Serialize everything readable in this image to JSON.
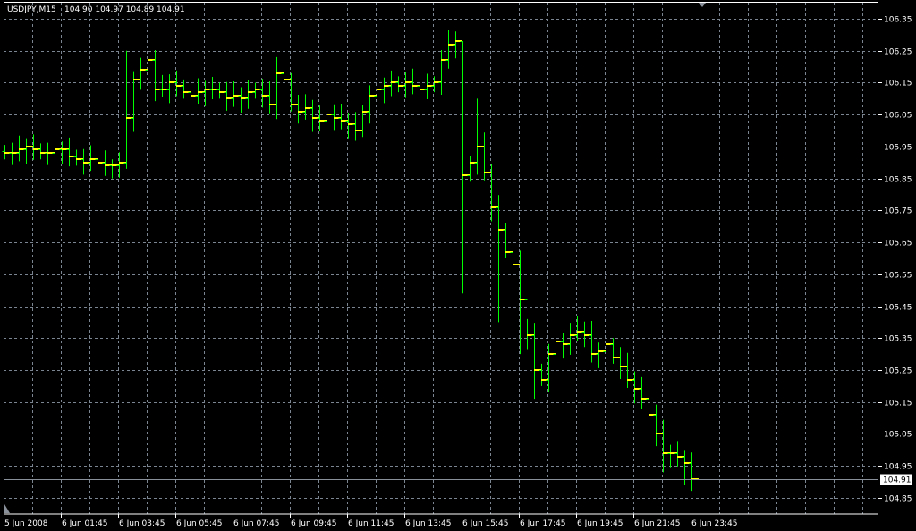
{
  "header": {
    "symbol": "USDJPY,M15",
    "ohlc": "104.90 104.97 104.89 104.91"
  },
  "colors": {
    "background": "#000000",
    "grid": "#7a8591",
    "bar_up": "#00ff00",
    "close_tick": "#ffff00",
    "axis": "#ffffff",
    "bid_line": "#8a9099"
  },
  "current_price": "104.91",
  "chart_data": {
    "type": "ohlc",
    "title": "USDJPY,M15",
    "timeframe": "M15",
    "ylim": [
      104.8,
      106.4
    ],
    "y_ticks": [
      "106.35",
      "106.25",
      "106.15",
      "106.05",
      "105.95",
      "105.85",
      "105.75",
      "105.65",
      "105.55",
      "105.45",
      "105.35",
      "105.25",
      "105.15",
      "105.05",
      "104.95",
      "104.85"
    ],
    "x_ticks": [
      "5 Jun 2008",
      "6 Jun 01:45",
      "6 Jun 03:45",
      "6 Jun 05:45",
      "6 Jun 07:45",
      "6 Jun 09:45",
      "6 Jun 11:45",
      "6 Jun 13:45",
      "6 Jun 15:45",
      "6 Jun 17:45",
      "6 Jun 19:45",
      "6 Jun 21:45",
      "6 Jun 23:45"
    ],
    "first_bar_time": "5 Jun 23:45",
    "bar_minutes": 15,
    "close": [
      105.93,
      105.93,
      105.94,
      105.95,
      105.94,
      105.93,
      105.93,
      105.94,
      105.94,
      105.92,
      105.91,
      105.9,
      105.91,
      105.9,
      105.89,
      105.89,
      105.9,
      106.04,
      106.16,
      106.19,
      106.22,
      106.13,
      106.13,
      106.15,
      106.14,
      106.12,
      106.11,
      106.12,
      106.13,
      106.13,
      106.12,
      106.1,
      106.11,
      106.1,
      106.12,
      106.13,
      106.11,
      106.08,
      106.18,
      106.16,
      106.08,
      106.06,
      106.07,
      106.04,
      106.03,
      106.05,
      106.04,
      106.03,
      106.02,
      106.0,
      106.06,
      106.11,
      106.13,
      106.14,
      106.15,
      106.14,
      106.15,
      106.14,
      106.13,
      106.14,
      106.15,
      106.22,
      106.27,
      106.28,
      105.86,
      105.9,
      105.95,
      105.87,
      105.76,
      105.69,
      105.62,
      105.58,
      105.47,
      105.36,
      105.25,
      105.22,
      105.3,
      105.34,
      105.33,
      105.36,
      105.37,
      105.36,
      105.3,
      105.31,
      105.33,
      105.29,
      105.26,
      105.22,
      105.19,
      105.16,
      105.11,
      105.05,
      104.99,
      104.99,
      104.98,
      104.96,
      104.91
    ],
    "high_override": {
      "17": 106.25,
      "20": 106.27,
      "38": 106.23,
      "63": 106.31,
      "64": 106.28,
      "66": 106.1,
      "73": 105.41,
      "80": 105.42
    },
    "low_override": {
      "15": 105.85,
      "17": 105.88,
      "64": 105.49,
      "69": 105.4,
      "72": 105.3,
      "74": 105.16,
      "92": 104.93,
      "95": 104.89
    }
  }
}
